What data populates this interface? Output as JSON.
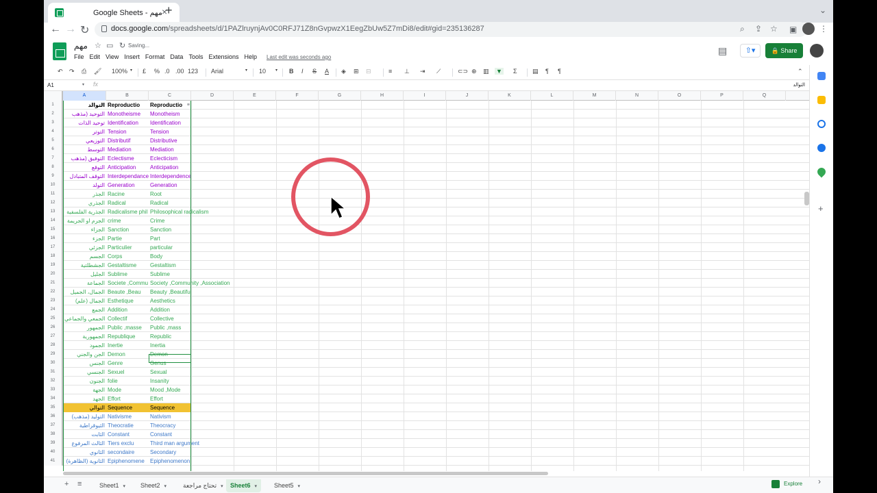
{
  "browser": {
    "tab_title": "Google Sheets - مهم",
    "url_domain": "docs.google.com",
    "url_path": "/spreadsheets/d/1PAZlruynjAv0C0RFJ71Z8nGvpwzX1EegZbUw5Z7mDi8/edit#gid=235136287"
  },
  "doc": {
    "title": "مهم",
    "status": "Saving...",
    "last_edit": "Last edit was seconds ago",
    "share_label": "Share"
  },
  "menus": [
    "File",
    "Edit",
    "View",
    "Insert",
    "Format",
    "Data",
    "Tools",
    "Extensions",
    "Help"
  ],
  "toolbar": {
    "zoom": "100%",
    "currency": "£",
    "percent": "%",
    "dec_less": ".0",
    "dec_more": ".00",
    "number_format": "123",
    "font": "Arial",
    "font_size": "10",
    "bold": "B",
    "italic": "I",
    "strike": "S",
    "text_color": "A"
  },
  "formula_bar": {
    "cell_ref": "A1",
    "fx": "fx",
    "value": "التوالد"
  },
  "columns": [
    "A",
    "B",
    "C",
    "D",
    "E",
    "F",
    "G",
    "H",
    "I",
    "J",
    "K",
    "L",
    "M",
    "N",
    "O",
    "P",
    "Q"
  ],
  "rows": [
    {
      "n": "1",
      "a": "التوالد",
      "b": "Reproductio",
      "c": "Reproductio",
      "color": "header"
    },
    {
      "n": "2",
      "a": "التوحيد (مذهب",
      "b": "Monotheisme",
      "c": "Monotheism",
      "color": "purple"
    },
    {
      "n": "3",
      "a": "توحيد الذات",
      "b": "Identification",
      "c": "Identification",
      "color": "purple"
    },
    {
      "n": "4",
      "a": "التوتر",
      "b": "Tension",
      "c": "Tension",
      "color": "purple"
    },
    {
      "n": "5",
      "a": "التوزيعي",
      "b": "Distributif",
      "c": "Distributive",
      "color": "purple"
    },
    {
      "n": "6",
      "a": "التوسط",
      "b": "Mediation",
      "c": "Mediation",
      "color": "purple"
    },
    {
      "n": "7",
      "a": "التوفيق (مذهب",
      "b": "Eclectisme",
      "c": "Eclecticism",
      "color": "purple"
    },
    {
      "n": "8",
      "a": "التوقع",
      "b": "Anticipation",
      "c": "Anticipation",
      "color": "purple"
    },
    {
      "n": "9",
      "a": "التوقف المتبادل",
      "b": "Interdependance",
      "c": "Interdependence",
      "color": "purple"
    },
    {
      "n": "10",
      "a": "التولد",
      "b": "Generation",
      "c": "Generation",
      "color": "purple"
    },
    {
      "n": "11",
      "a": "الجذر",
      "b": "Racine",
      "c": "Root",
      "color": "green"
    },
    {
      "n": "12",
      "a": "الجذري",
      "b": "Radical",
      "c": "Radical",
      "color": "green"
    },
    {
      "n": "13",
      "a": "الجذرية الفلسفية",
      "b": "Radicalisme phil",
      "c": "Philosophical radicalism",
      "color": "green"
    },
    {
      "n": "14",
      "a": "الجرم او الجريمة",
      "b": "crime",
      "c": "Crime",
      "color": "green"
    },
    {
      "n": "15",
      "a": "الجزاء",
      "b": "Sanction",
      "c": "Sanction",
      "color": "green"
    },
    {
      "n": "16",
      "a": "الجزء",
      "b": "Partie",
      "c": "Part",
      "color": "green"
    },
    {
      "n": "17",
      "a": "الجزئي",
      "b": "Particulier",
      "c": "particular",
      "color": "green"
    },
    {
      "n": "18",
      "a": "الجسم",
      "b": "Corps",
      "c": "Body",
      "color": "green"
    },
    {
      "n": "19",
      "a": "الجشطلتية",
      "b": "Gestaltisme",
      "c": "Gestaltism",
      "color": "green"
    },
    {
      "n": "20",
      "a": "الجليل",
      "b": "Sublime",
      "c": "Sublime",
      "color": "green"
    },
    {
      "n": "21",
      "a": "الجماعة",
      "b": "Societe ,Commu",
      "c": "Society ,Community ,Association",
      "color": "green"
    },
    {
      "n": "22",
      "a": "الجمال، الجميل",
      "b": "Beaute ,Beau",
      "c": "Beauty ,Beautiful",
      "color": "green"
    },
    {
      "n": "23",
      "a": "(الجمال (علم",
      "b": "Esthetique",
      "c": "Aesthetics",
      "color": "green"
    },
    {
      "n": "24",
      "a": "الجمع",
      "b": "Addition",
      "c": "Addition",
      "color": "green"
    },
    {
      "n": "25",
      "a": "الجمعي والجماعي",
      "b": "Collectif",
      "c": "Collective",
      "color": "green"
    },
    {
      "n": "26",
      "a": "الجمهور",
      "b": "Public ,masse",
      "c": "Public ,mass",
      "color": "green"
    },
    {
      "n": "27",
      "a": "الجمهورية",
      "b": "Republique",
      "c": "Republic",
      "color": "green"
    },
    {
      "n": "28",
      "a": "الجمود",
      "b": "Inertie",
      "c": "Inertia",
      "color": "green"
    },
    {
      "n": "29",
      "a": "الجن والجني",
      "b": "Demon",
      "c": "Demon",
      "color": "green"
    },
    {
      "n": "30",
      "a": "الجنس",
      "b": "Genre",
      "c": "Genus",
      "color": "green"
    },
    {
      "n": "31",
      "a": "الجنسي",
      "b": "Sexuel",
      "c": "Sexual",
      "color": "green"
    },
    {
      "n": "32",
      "a": "الجنون",
      "b": "folie",
      "c": "Insanity",
      "color": "green"
    },
    {
      "n": "33",
      "a": "الجهة",
      "b": "Mode",
      "c": "Mood ,Mode",
      "color": "green"
    },
    {
      "n": "34",
      "a": "الجهد",
      "b": "Effort",
      "c": "Effort",
      "color": "green"
    },
    {
      "n": "35",
      "a": "التوالي",
      "b": "Sequence",
      "c": "Sequence",
      "color": "highlight"
    },
    {
      "n": "36",
      "a": "(التوليد (مذهب",
      "b": "Nativisme",
      "c": "Nativism",
      "color": "blue"
    },
    {
      "n": "37",
      "a": "الثيوقراطية",
      "b": "Theocratie",
      "c": "Theocracy",
      "color": "blue"
    },
    {
      "n": "38",
      "a": "الثابت",
      "b": "Constant",
      "c": "Constant",
      "color": "blue"
    },
    {
      "n": "39",
      "a": "الثالث المرفوع",
      "b": "Tiers exclu",
      "c": "Third man argument",
      "color": "blue"
    },
    {
      "n": "40",
      "a": "الثانوي",
      "b": "secondaire",
      "c": "Secondary",
      "color": "blue"
    },
    {
      "n": "41",
      "a": "(الثانوية (الظاهرة",
      "b": "Epiphenomene",
      "c": "Epiphenomenon",
      "color": "blue"
    }
  ],
  "sheets": [
    {
      "label": "Sheet1",
      "active": false
    },
    {
      "label": "Sheet2",
      "active": false
    },
    {
      "label": "تحتاج مراجعة",
      "active": false
    },
    {
      "label": "Sheet6",
      "active": true
    },
    {
      "label": "Sheet5",
      "active": false
    }
  ],
  "explore_label": "Explore",
  "colors": {
    "share": "#188038",
    "highlight_row": "#f1c232",
    "purple_text": "#9900cc",
    "green_text": "#34a853",
    "blue_text": "#3d78c8",
    "click_ring": "#e25563"
  }
}
